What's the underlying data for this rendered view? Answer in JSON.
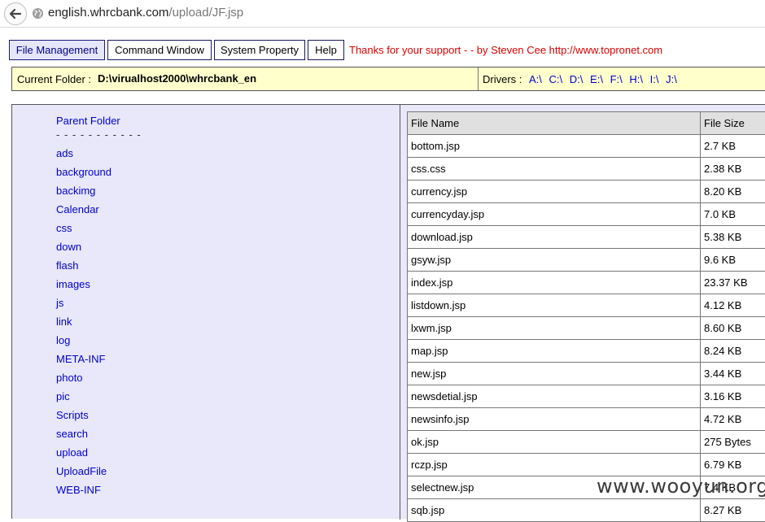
{
  "browser": {
    "url_host": "english.whrcbank.com",
    "url_path": "/upload/JF.jsp"
  },
  "menu": {
    "items": [
      {
        "label": "File Management"
      },
      {
        "label": "Command Window"
      },
      {
        "label": "System Property"
      },
      {
        "label": "Help"
      }
    ],
    "credit": "Thanks for your support - - by Steven Cee http://www.topronet.com"
  },
  "folderbar": {
    "label": "Current Folder :",
    "path": "D:\\virualhost2000\\whrcbank_en",
    "drivers_label": "Drivers :",
    "drives": [
      "A:\\",
      "C:\\",
      "D:\\",
      "E:\\",
      "F:\\",
      "H:\\",
      "I:\\",
      "J:\\"
    ]
  },
  "folders": {
    "parent": "Parent Folder",
    "separator": "- - - - - - - - - - -",
    "items": [
      "ads",
      "background",
      "backimg",
      "Calendar",
      "css",
      "down",
      "flash",
      "images",
      "js",
      "link",
      "log",
      "META-INF",
      "photo",
      "pic",
      "Scripts",
      "search",
      "upload",
      "UploadFile",
      "WEB-INF"
    ]
  },
  "files": {
    "headers": [
      "File Name",
      "File Size"
    ],
    "rows": [
      [
        "bottom.jsp",
        "2.7 KB"
      ],
      [
        "css.css",
        "2.38 KB"
      ],
      [
        "currency.jsp",
        "8.20 KB"
      ],
      [
        "currencyday.jsp",
        "7.0 KB"
      ],
      [
        "download.jsp",
        "5.38 KB"
      ],
      [
        "gsyw.jsp",
        "9.6 KB"
      ],
      [
        "index.jsp",
        "23.37 KB"
      ],
      [
        "listdown.jsp",
        "4.12 KB"
      ],
      [
        "lxwm.jsp",
        "8.60 KB"
      ],
      [
        "map.jsp",
        "8.24 KB"
      ],
      [
        "new.jsp",
        "3.44 KB"
      ],
      [
        "newsdetial.jsp",
        "3.16 KB"
      ],
      [
        "newsinfo.jsp",
        "4.72 KB"
      ],
      [
        "ok.jsp",
        "275 Bytes"
      ],
      [
        "rczp.jsp",
        "6.79 KB"
      ],
      [
        "selectnew.jsp",
        "7.4 KB"
      ],
      [
        "sqb.jsp",
        "8.27 KB"
      ]
    ]
  },
  "watermark": "www.wooyun.org",
  "colors": {
    "folder_bar_bg": "#ffffcc",
    "panel_bg": "#e8e8fa",
    "link": "#0000cc",
    "credit": "#e00000"
  }
}
